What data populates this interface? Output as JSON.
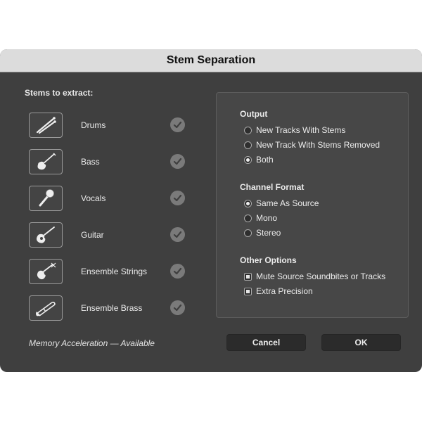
{
  "dialog": {
    "title": "Stem Separation"
  },
  "stems": {
    "heading": "Stems to extract:",
    "items": [
      {
        "label": "Drums",
        "icon": "drumsticks-icon",
        "selected": true
      },
      {
        "label": "Bass",
        "icon": "bass-guitar-icon",
        "selected": true
      },
      {
        "label": "Vocals",
        "icon": "microphone-icon",
        "selected": true
      },
      {
        "label": "Guitar",
        "icon": "acoustic-guitar-icon",
        "selected": true
      },
      {
        "label": "Ensemble Strings",
        "icon": "violin-icon",
        "selected": true
      },
      {
        "label": "Ensemble Brass",
        "icon": "trombone-icon",
        "selected": true
      }
    ]
  },
  "memory_status": "Memory Acceleration — Available",
  "options": {
    "output": {
      "title": "Output",
      "choices": [
        "New Tracks With Stems",
        "New Track With Stems Removed",
        "Both"
      ],
      "selected": "Both"
    },
    "channel_format": {
      "title": "Channel Format",
      "choices": [
        "Same As Source",
        "Mono",
        "Stereo"
      ],
      "selected": "Same As Source"
    },
    "other": {
      "title": "Other Options",
      "choices": [
        {
          "label": "Mute Source Soundbites or Tracks",
          "checked": true
        },
        {
          "label": "Extra Precision",
          "checked": true
        }
      ]
    }
  },
  "buttons": {
    "cancel": "Cancel",
    "ok": "OK"
  },
  "colors": {
    "background": "#3f3f3f",
    "titlebar": "#dcdcdc",
    "panel": "#474747",
    "button": "#2b2b2b"
  }
}
